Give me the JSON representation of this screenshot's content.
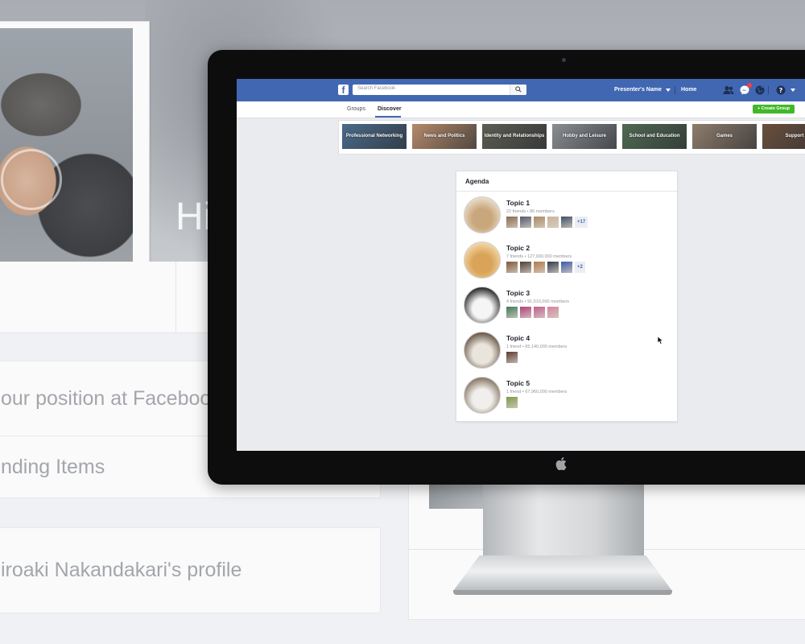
{
  "background_page": {
    "cover_text": "Hi",
    "cards": [
      "our position at Faceboo",
      "nding Items",
      "iroaki Nakandakari's profile"
    ]
  },
  "facebook": {
    "search_placeholder": "Search Facebook",
    "user_name": "Presenter's Name",
    "home_link": "Home",
    "logo_letter": "f",
    "tabs": [
      "Groups",
      "Discover"
    ],
    "active_tab": "Discover",
    "create_group_label": "+ Create Group",
    "categories": [
      {
        "label": "Professional Networking",
        "color": "#4a6b8a"
      },
      {
        "label": "News and Politics",
        "color": "#b48a6a"
      },
      {
        "label": "Identity and Relationships",
        "color": "#5c5d52"
      },
      {
        "label": "Hobby and Leisure",
        "color": "#8a8d91"
      },
      {
        "label": "School and Education",
        "color": "#4f6a52"
      },
      {
        "label": "Games",
        "color": "#8e7d6c"
      },
      {
        "label": "Support",
        "color": "#6a4f3d"
      }
    ]
  },
  "agenda": {
    "title": "Agenda",
    "topics": [
      {
        "name": "Topic 1",
        "meta": "22 friends • 86 members",
        "more": "+17",
        "thumbs": [
          "#8a6a4e",
          "#50596a",
          "#a88964",
          "#c9b49c",
          "#3d4f63"
        ],
        "avatar": [
          "#c9a77c",
          "#e8dcc8"
        ]
      },
      {
        "name": "Topic 2",
        "meta": "7 friends • 127,000,000 members",
        "more": "+2",
        "thumbs": [
          "#7d5a3c",
          "#4e3d33",
          "#b07a4e",
          "#2f3a4d",
          "#3b5ba8"
        ],
        "avatar": [
          "#d9a45a",
          "#f2d7a6"
        ]
      },
      {
        "name": "Topic 3",
        "meta": "4 friends • 91,510,000 members",
        "more": "",
        "thumbs": [
          "#3e7a5a",
          "#b0407a",
          "#c05e8e",
          "#d2849e"
        ],
        "avatar": [
          "#f5f5f5",
          "#2b2b2b"
        ]
      },
      {
        "name": "Topic 4",
        "meta": "1 friend • 65,140,000 members",
        "more": "",
        "thumbs": [
          "#5a3a30"
        ],
        "avatar": [
          "#e9e4dc",
          "#6b5a49"
        ]
      },
      {
        "name": "Topic 5",
        "meta": "1 friend • 67,960,000 members",
        "more": "",
        "thumbs": [
          "#7a9a4a"
        ],
        "avatar": [
          "#f0efec",
          "#8a7a66"
        ]
      }
    ]
  }
}
